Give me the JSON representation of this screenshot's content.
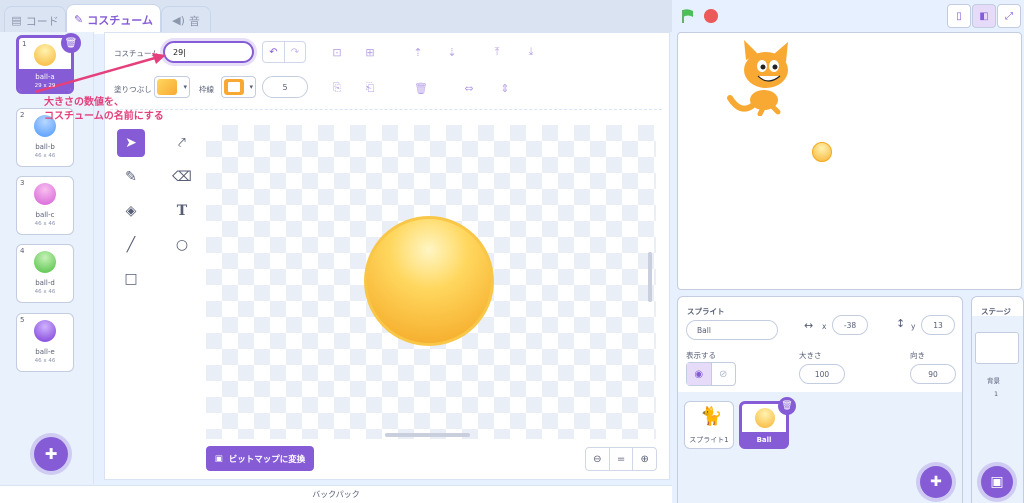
{
  "tabs": [
    {
      "label": "コード",
      "icon": "code-icon"
    },
    {
      "label": "コスチューム",
      "icon": "brush-icon"
    },
    {
      "label": "音",
      "icon": "speaker-icon"
    }
  ],
  "costumes": [
    {
      "num": "1",
      "name": "ball-a",
      "size": "29 x 29",
      "color": "#f7b333"
    },
    {
      "num": "2",
      "name": "ball-b",
      "size": "46 x 46",
      "color": "#4c97ff"
    },
    {
      "num": "3",
      "name": "ball-c",
      "size": "46 x 46",
      "color": "#d65cd6"
    },
    {
      "num": "4",
      "name": "ball-d",
      "size": "46 x 46",
      "color": "#4cbf3f"
    },
    {
      "num": "5",
      "name": "ball-e",
      "size": "46 x 46",
      "color": "#7a3ad6"
    }
  ],
  "editor": {
    "costume_label": "コスチューム",
    "costume_name": "29",
    "fill_label": "塗りつぶし",
    "outline_label": "枠線",
    "stroke_width": "5",
    "bitmap_button": "ビットマップに変換"
  },
  "annotation": {
    "line1": "大きさの数値を、",
    "line2": "コスチュームの名前にする"
  },
  "backpack_label": "バックパック",
  "sprite_info": {
    "sprite_label": "スプライト",
    "sprite_name": "Ball",
    "x_label": "x",
    "x_value": "-38",
    "y_label": "y",
    "y_value": "13",
    "show_label": "表示する",
    "size_label": "大きさ",
    "size_value": "100",
    "direction_label": "向き",
    "direction_value": "90"
  },
  "sprites": [
    {
      "name": "スプライト1"
    },
    {
      "name": "Ball"
    }
  ],
  "stage_panel": {
    "title": "ステージ",
    "backdrop_label": "背景",
    "backdrop_count": "1"
  },
  "colors": {
    "accent": "#855cd6",
    "annotation": "#e4407c",
    "ball": "#f7b333"
  }
}
